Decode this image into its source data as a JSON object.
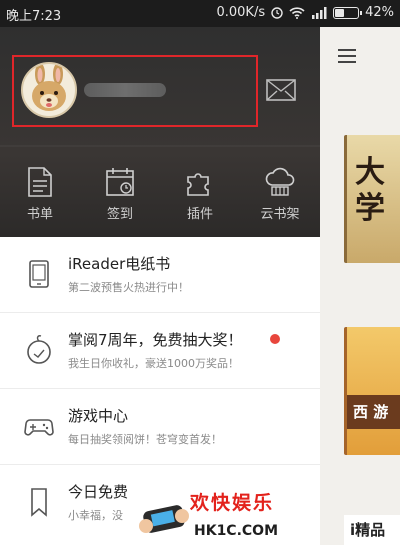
{
  "status_bar": {
    "time": "晚上7:23",
    "net_speed": "0.00K/s",
    "battery": "42%",
    "battery_level": 0.42
  },
  "drawer": {
    "quick_actions": [
      {
        "label": "书单",
        "icon": "document-icon"
      },
      {
        "label": "签到",
        "icon": "calendar-icon"
      },
      {
        "label": "插件",
        "icon": "puzzle-icon"
      },
      {
        "label": "云书架",
        "icon": "cloud-shelf-icon"
      }
    ],
    "items": [
      {
        "title": "iReader电纸书",
        "sub": "第二波预售火热进行中！",
        "icon": "ereader-icon"
      },
      {
        "title": "掌阅7周年，免费抽大奖！",
        "sub": "我生日你收礼，豪送1000万奖品！",
        "icon": "anniversary-icon",
        "badge_color": "#e8463c"
      },
      {
        "title": "游戏中心",
        "sub": "每日抽奖领阅饼！苍穹变首发！",
        "icon": "gamepad-icon"
      },
      {
        "title": "今日免费",
        "sub": "小幸福，没",
        "icon": "bookmark-icon"
      }
    ]
  },
  "main": {
    "books": [
      {
        "cover_text": "大\n学"
      },
      {
        "cover_text": "西 游"
      },
      {
        "cover_text": "i精品"
      }
    ]
  },
  "watermark": {
    "cn": "欢快娱乐",
    "en": "HK1C.COM"
  }
}
